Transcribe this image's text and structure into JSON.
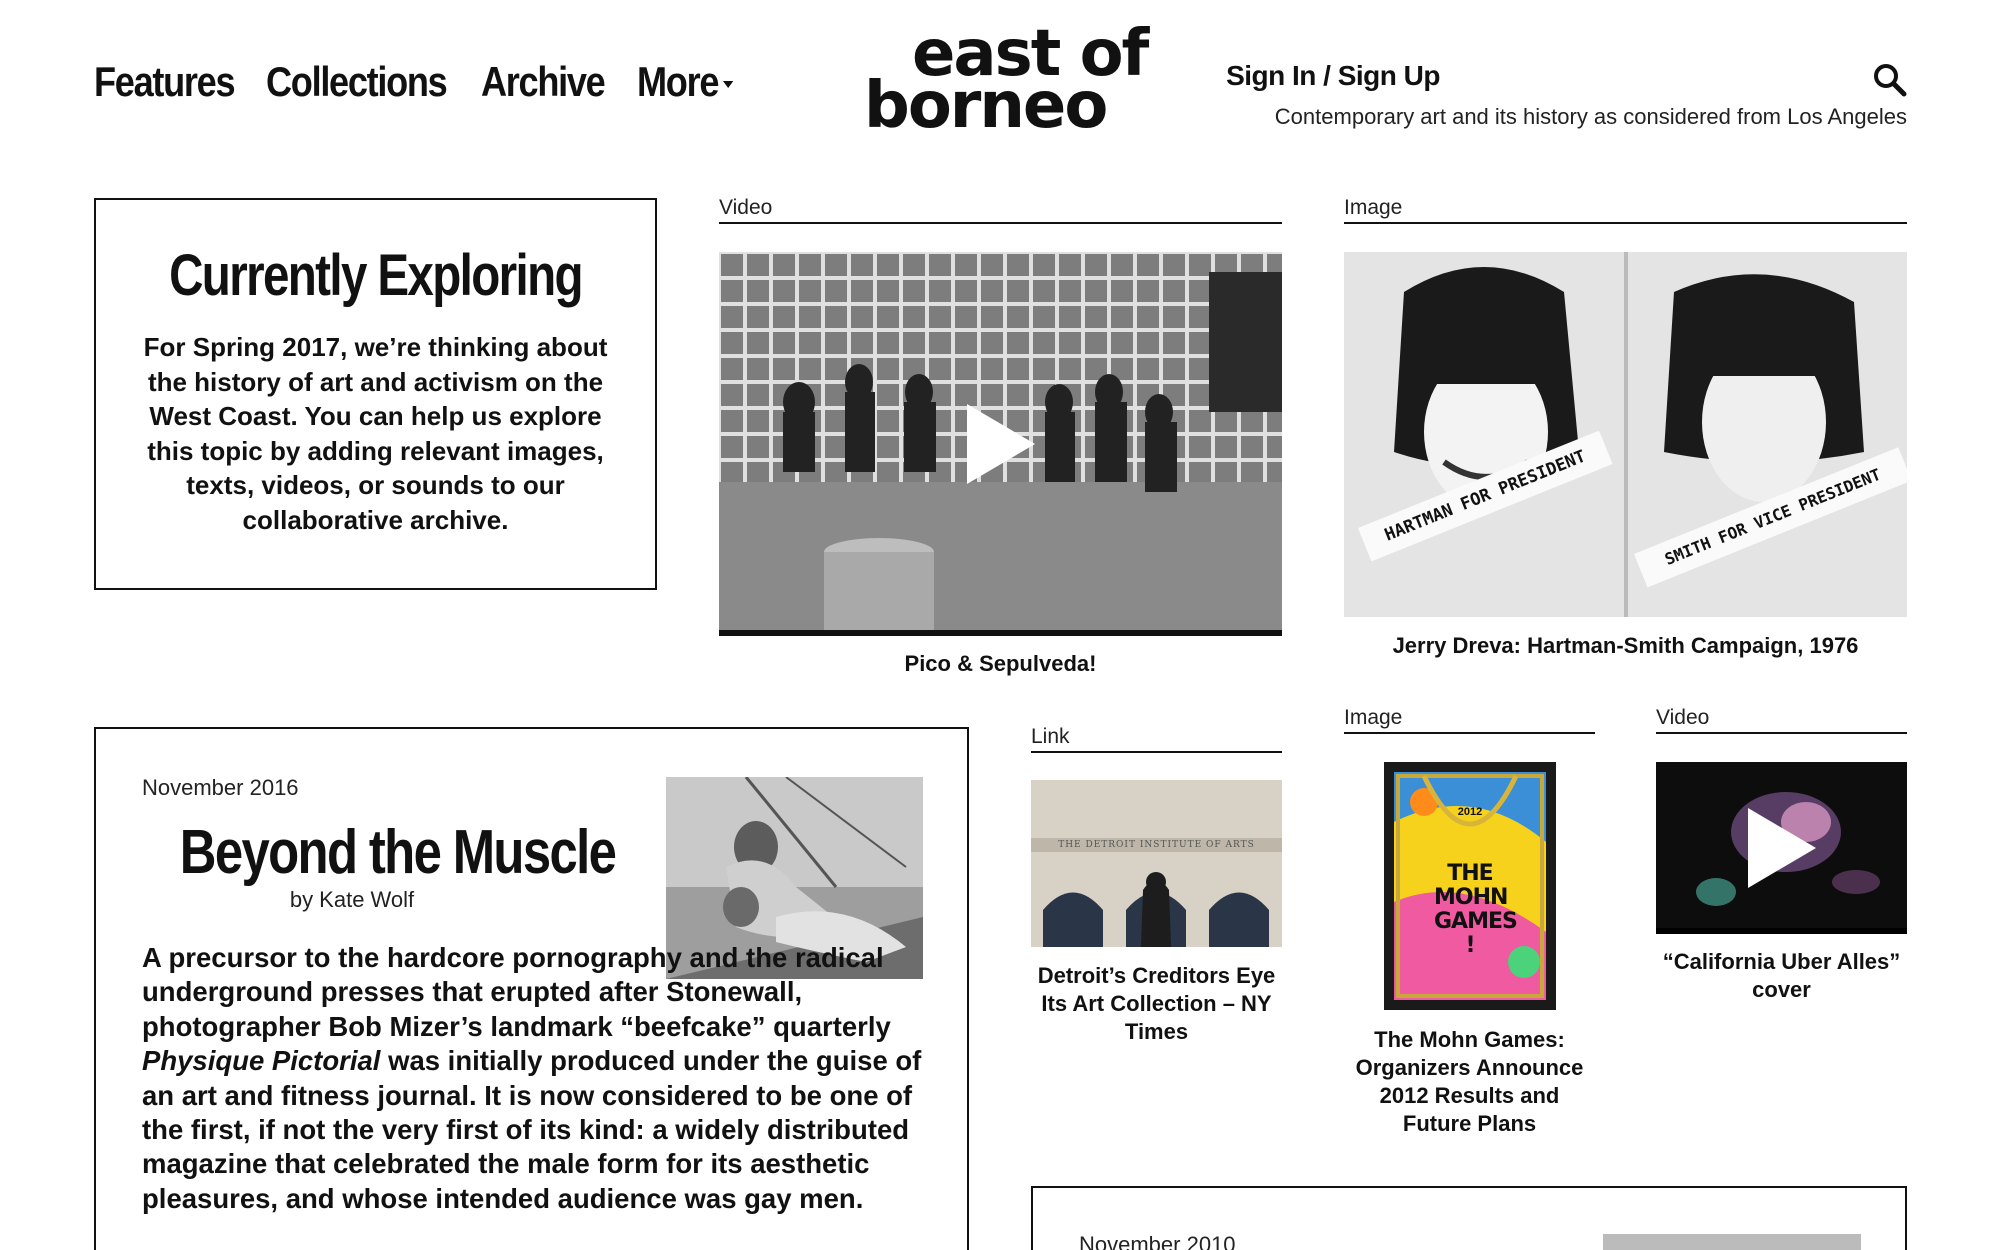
{
  "nav": {
    "items": [
      {
        "label": "Features"
      },
      {
        "label": "Collections"
      },
      {
        "label": "Archive"
      },
      {
        "label": "More"
      }
    ]
  },
  "logo": {
    "line1": "east of",
    "line2": "borneo"
  },
  "header": {
    "signin_label": "Sign In / Sign Up",
    "tagline": "Contemporary art and its history as considered from Los Angeles"
  },
  "currently_exploring": {
    "title": "Currently Exploring",
    "text": "For Spring 2017, we’re thinking about the history of art and activism on the West Coast. You can help us explore this topic by adding relevant images, texts, videos, or sounds to our collaborative archive."
  },
  "cards": {
    "video1": {
      "label": "Video",
      "caption": "Pico & Sepulveda!"
    },
    "image1": {
      "label": "Image",
      "caption": "Jerry Dreva: Hartman-Smith Campaign, 1976",
      "sash_left": "HARTMAN FOR PRESIDENT",
      "sash_right": "SMITH FOR VICE PRESIDENT"
    },
    "link1": {
      "label": "Link",
      "caption": "Detroit’s Creditors Eye Its Art Collection – NY Times",
      "building_text": "THE DETROIT INSTITUTE OF ARTS"
    },
    "image2": {
      "label": "Image",
      "caption": "The Mohn Games: Organizers Announce 2012 Results and Future Plans",
      "poster_year": "2012",
      "poster_text": "THE MOHN GAMES !"
    },
    "video2": {
      "label": "Video",
      "caption": "“California Uber Alles” cover"
    }
  },
  "feature_article": {
    "date": "November 2016",
    "title": "Beyond the Muscle",
    "author": "by Kate Wolf",
    "body_part1": "A precursor to the hardcore pornography and the radical underground presses that erupted after Stonewall, photographer Bob Mizer’s landmark “beefcake” quarterly",
    "body_italic": "Physique Pictorial",
    "body_part2": "was initially produced under the guise of an art and fitness journal. It is now considered to be one of the first, if not the very first of its kind: a widely distributed magazine that celebrated the male form for its aesthetic pleasures, and whose intended audience was gay men."
  },
  "second_article": {
    "date": "November 2010"
  },
  "colors": {
    "text": "#111111",
    "background": "#ffffff",
    "border": "#111111"
  }
}
